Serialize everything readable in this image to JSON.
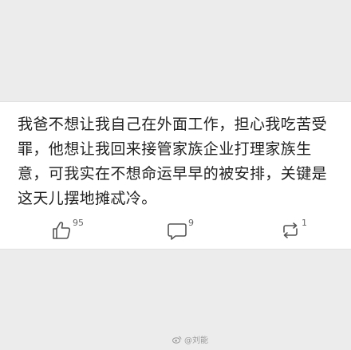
{
  "post": {
    "text": "我爸不想让我自己在外面工作，担心我吃苦受罪，他想让我回来接管家族企业打理家族生意，可我实在不想命运早早的被安排，关键是这天儿摆地摊忒冷。"
  },
  "actions": {
    "like_count": "95",
    "comment_count": "9",
    "repost_count": "1"
  },
  "watermark": {
    "text": "@刘能"
  },
  "colors": {
    "page_bg": "#ececec",
    "card_bg": "#ffffff",
    "text": "#222222",
    "icon": "#555555"
  }
}
